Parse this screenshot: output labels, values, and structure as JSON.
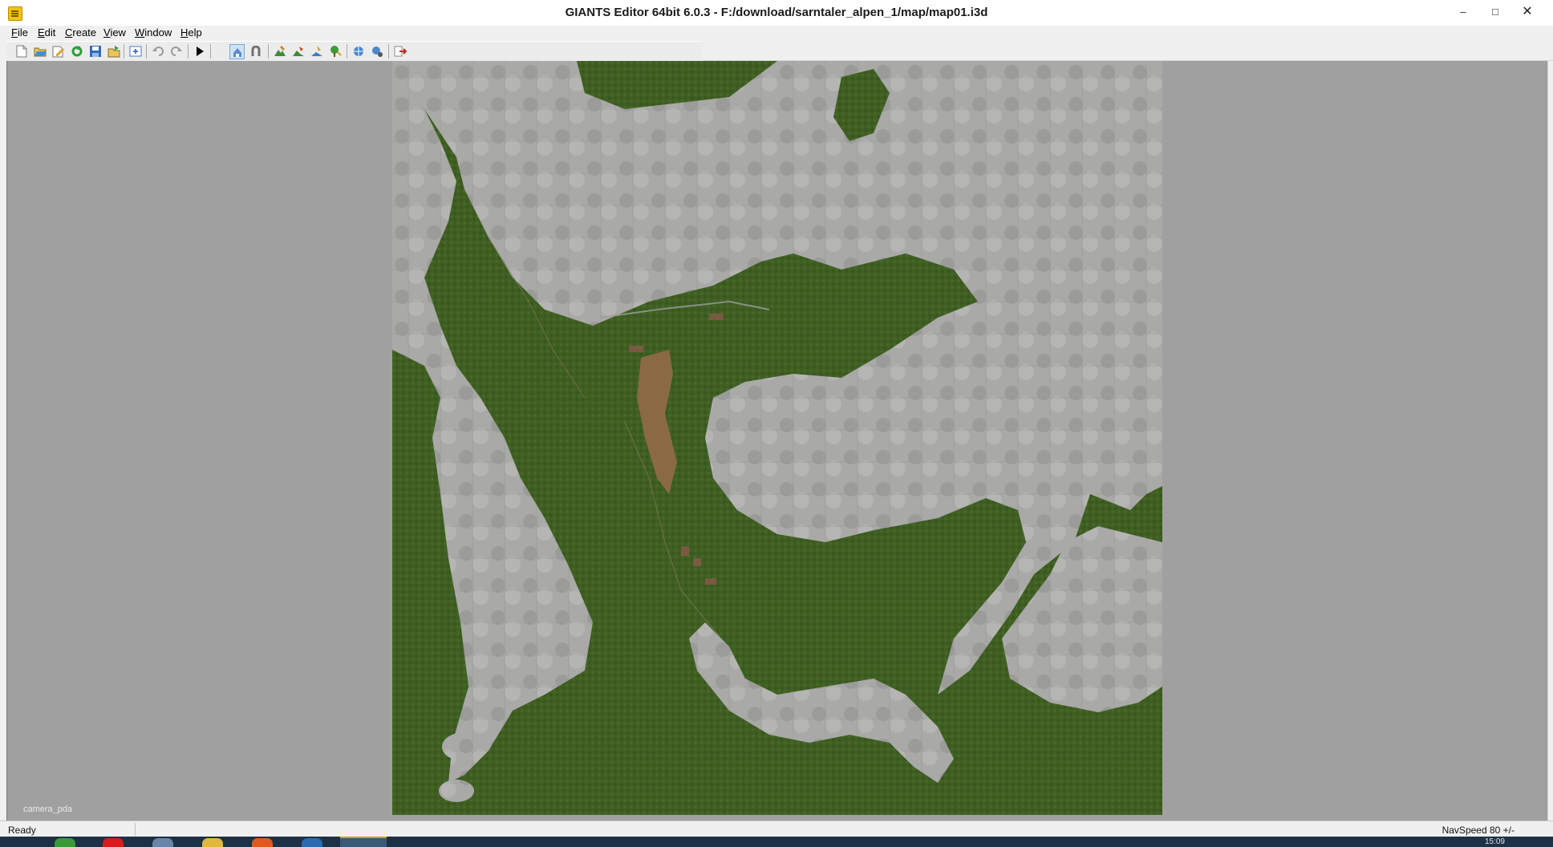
{
  "window": {
    "title": "GIANTS Editor 64bit 6.0.3 - F:/download/sarntaler_alpen_1/map/map01.i3d",
    "controls": {
      "minimize": "–",
      "maximize": "□",
      "close": "✕"
    }
  },
  "menu": [
    {
      "key": "F",
      "rest": "ile"
    },
    {
      "key": "E",
      "rest": "dit"
    },
    {
      "key": "C",
      "rest": "reate"
    },
    {
      "key": "V",
      "rest": "iew"
    },
    {
      "key": "W",
      "rest": "indow"
    },
    {
      "key": "H",
      "rest": "elp"
    }
  ],
  "toolbar_icons": [
    "new-file-icon",
    "open-file-icon",
    "edit-file-icon",
    "reload-icon",
    "save-icon",
    "export-icon",
    "import-icon",
    "undo-icon",
    "redo-icon",
    "play-icon",
    "camera-select-icon",
    "magnet-icon",
    "terrain-sculpt-icon",
    "terrain-paint-icon",
    "foliage-paint-icon",
    "tree-icon",
    "network-icon",
    "network-settings-icon",
    "exit-icon"
  ],
  "viewport": {
    "camera_label": "camera_pda"
  },
  "status": {
    "left": "Ready",
    "right": "NavSpeed 80 +/-"
  },
  "taskbar": {
    "clock": "15:09"
  },
  "colors": {
    "grass": "#3f5f22",
    "rock": "#a6a6a4",
    "field": "#8a6a45",
    "viewport_bg": "#a0a0a0"
  }
}
